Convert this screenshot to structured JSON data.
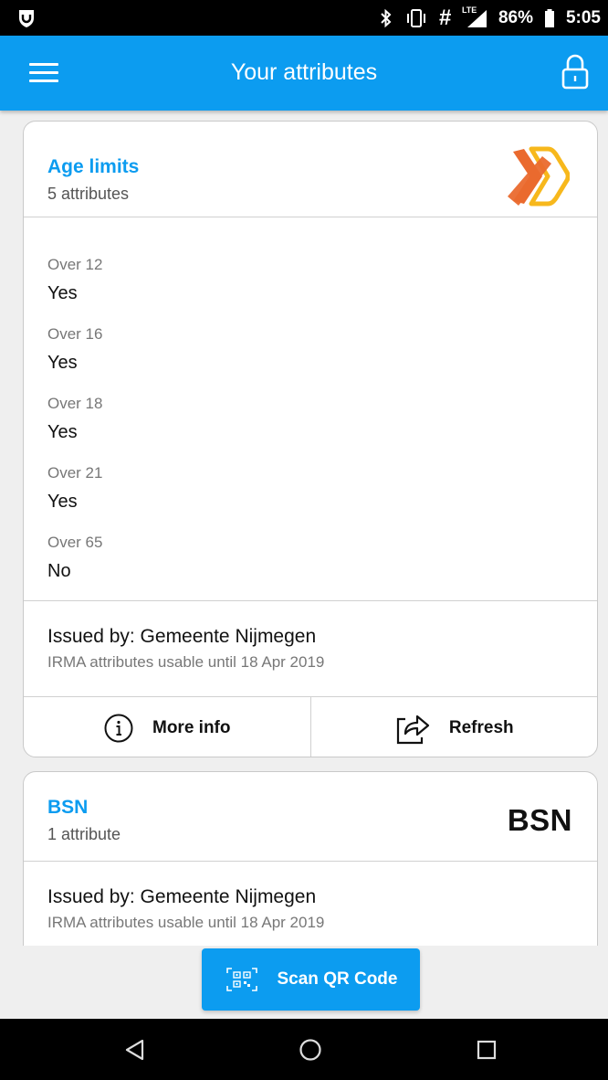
{
  "status_bar": {
    "notification_icon": "shield-notification-icon",
    "bluetooth_icon": "bluetooth-icon",
    "vibrate_icon": "vibrate-icon",
    "hash_icon": "hash-icon",
    "network_label": "LTE",
    "battery": "86%",
    "time": "5:05"
  },
  "app_bar": {
    "title": "Your attributes",
    "menu_icon": "hamburger-menu-icon",
    "lock_icon": "lock-icon"
  },
  "cards": [
    {
      "title": "Age limits",
      "subtitle": "5 attributes",
      "logo": "x-logo",
      "attributes": [
        {
          "label": "Over 12",
          "value": "Yes"
        },
        {
          "label": "Over 16",
          "value": "Yes"
        },
        {
          "label": "Over 18",
          "value": "Yes"
        },
        {
          "label": "Over 21",
          "value": "Yes"
        },
        {
          "label": "Over 65",
          "value": "No"
        }
      ],
      "issuer": "Issued by: Gemeente Nijmegen",
      "validity": "IRMA attributes usable until 18 Apr 2019",
      "actions": {
        "more_info": "More info",
        "refresh": "Refresh"
      }
    },
    {
      "title": "BSN",
      "subtitle": "1 attribute",
      "logo_text": "BSN",
      "issuer": "Issued by: Gemeente Nijmegen",
      "validity": "IRMA attributes usable until 18 Apr 2019"
    }
  ],
  "scan_button": {
    "label": "Scan QR Code",
    "icon": "qr-code-icon"
  },
  "nav_bar": {
    "back_icon": "back-triangle-icon",
    "home_icon": "home-circle-icon",
    "recents_icon": "recents-square-icon"
  },
  "colors": {
    "primary": "#0c9cf0",
    "logo_orange": "#ea6a2e",
    "logo_yellow": "#f7b81c"
  }
}
